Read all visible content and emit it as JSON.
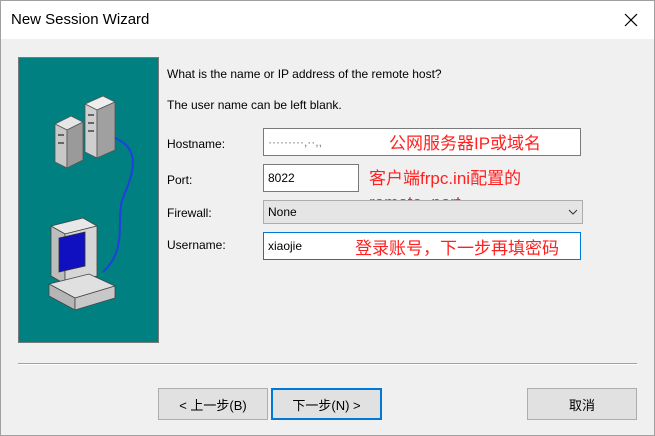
{
  "window": {
    "title": "New Session Wizard"
  },
  "icons": {
    "close": "close-icon",
    "computer": "computer-icon",
    "server": "server-icon",
    "dropdown": "chevron-down-icon"
  },
  "instructions": {
    "line1": "What is the name or IP address of the remote host?",
    "line2": "The user name can be left blank."
  },
  "form": {
    "hostname_label": "Hostname:",
    "hostname_value": "·········,··,,",
    "port_label": "Port:",
    "port_value": "8022",
    "firewall_label": "Firewall:",
    "firewall_value": "None",
    "username_label": "Username:",
    "username_value": "xiaojie"
  },
  "annotations": {
    "hostname_note": "公网服务器IP或域名",
    "port_note_line1": "客户端frpc.ini配置的",
    "port_note_line2": "remote_port",
    "username_note": "登录账号，下一步再填密码"
  },
  "buttons": {
    "back": "< 上一步(B)",
    "next": "下一步(N) >",
    "cancel": "取消"
  },
  "colors": {
    "art_bg": "#008080",
    "accent": "#0078d7",
    "annotation": "#ff2020"
  }
}
